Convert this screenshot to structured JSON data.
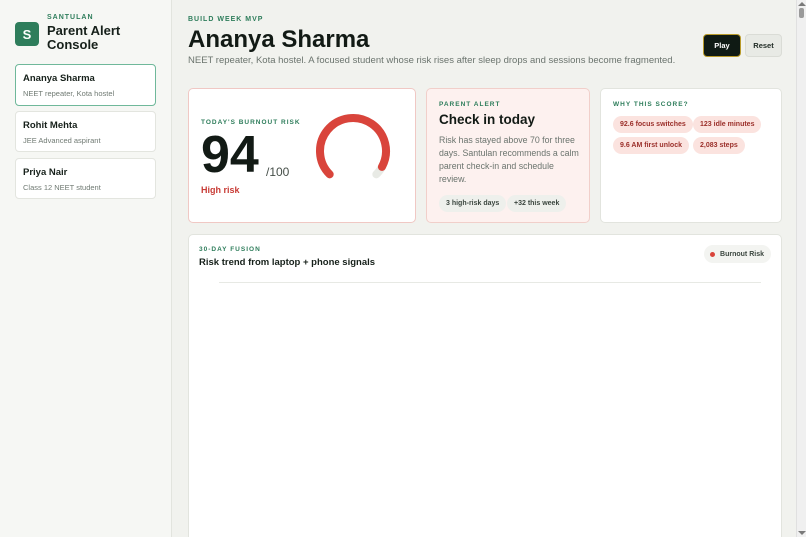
{
  "brand": {
    "mark": "S",
    "kicker": "SANTULAN",
    "title": "Parent Alert Console"
  },
  "students": [
    {
      "name": "Ananya Sharma",
      "sub": "NEET repeater, Kota hostel",
      "active": true
    },
    {
      "name": "Rohit Mehta",
      "sub": "JEE Advanced aspirant",
      "active": false
    },
    {
      "name": "Priya Nair",
      "sub": "Class 12 NEET student",
      "active": false
    }
  ],
  "header": {
    "eyebrow": "BUILD WEEK MVP",
    "title": "Ananya Sharma",
    "description": "NEET repeater, Kota hostel. A focused student whose risk rises after sleep drops and sessions become fragmented."
  },
  "buttons": {
    "play": "Play",
    "reset": "Reset"
  },
  "risk": {
    "kicker": "TODAY'S BURNOUT RISK",
    "value": "94",
    "max": "/100",
    "level": "High risk",
    "gauge_fraction": 0.94,
    "gauge_color": "#d9443b"
  },
  "alert": {
    "kicker": "PARENT ALERT",
    "title": "Check in today",
    "body": "Risk has stayed above 70 for three days. Santulan recommends a calm parent check-in and schedule review.",
    "pills": [
      "3 high-risk days",
      "+32 this week"
    ]
  },
  "why": {
    "kicker": "WHY THIS SCORE?",
    "pills": [
      "92.6 focus switches",
      "123 idle minutes",
      "9.6 AM first unlock",
      "2,083 steps"
    ]
  },
  "trend": {
    "kicker": "30-DAY FUSION",
    "title": "Risk trend from laptop + phone signals",
    "legend": "Burnout Risk"
  },
  "colors": {
    "accent": "#2e7d5b",
    "risk": "#d9443b",
    "alert_bg": "#fdf1ef"
  }
}
